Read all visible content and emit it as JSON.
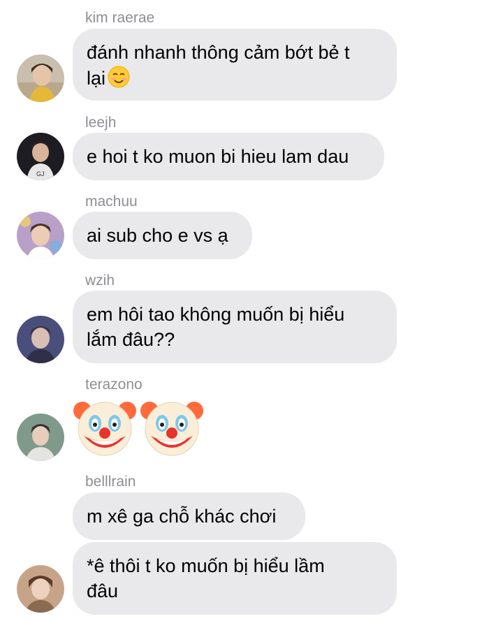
{
  "messages": [
    {
      "sender": "kim raerae",
      "text": "đánh nhanh thông cảm bớt bẻ t\nlại",
      "emoji": "smiling-face-icon"
    },
    {
      "sender": "leejh",
      "text": "e hoi t ko muon bi hieu lam dau"
    },
    {
      "sender": "machuu",
      "text": "ai sub cho e vs ạ"
    },
    {
      "sender": "wzih",
      "text": "em hôi tao không muốn bị hiểu\nlắm đâu??"
    },
    {
      "sender": "terazono",
      "emojis": [
        "clown-face-icon",
        "clown-face-icon"
      ]
    },
    {
      "sender": "belllrain",
      "texts": [
        "m xê ga chỗ khác chơi",
        "*ê thôi t ko muốn bị hiểu lầm\nđâu"
      ]
    }
  ],
  "colors": {
    "bubble": "#e9e9eb",
    "sender": "#8e8e93",
    "background": "#ffffff"
  }
}
